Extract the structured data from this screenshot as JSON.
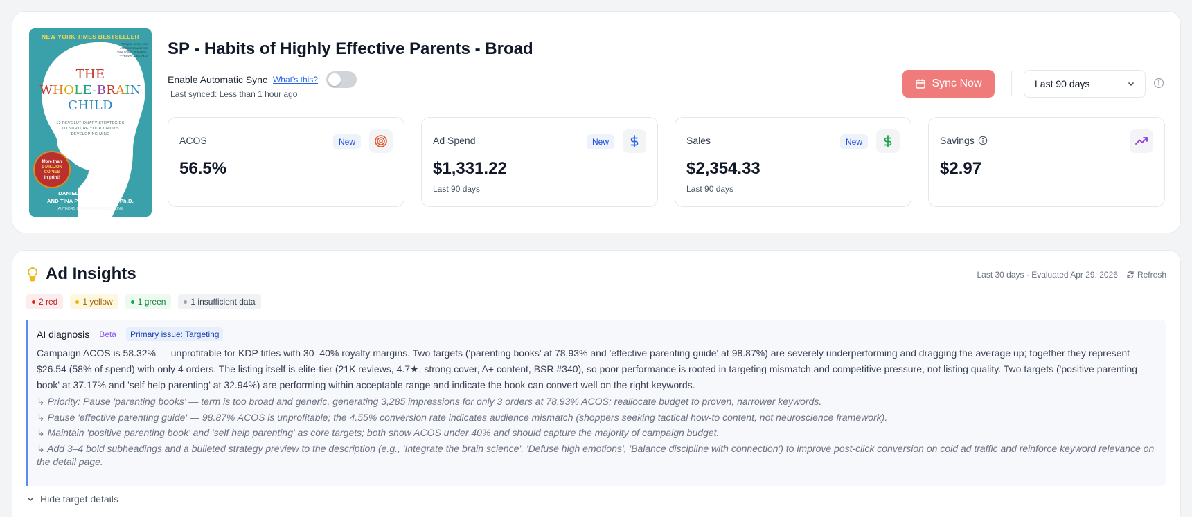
{
  "book_cover": {
    "nyt": "NEW YORK TIMES BESTSELLER",
    "quote": "\"Simple, smart, and effective solutions to your child's struggles.\" —Harvey Karp, M.D.",
    "title_line1": "THE",
    "title_line2": "WHOLE-BRAIN",
    "title_line3": "CHILD",
    "subtitle_line1": "12 REVOLUTIONARY STRATEGIES",
    "subtitle_line2": "TO NURTURE YOUR CHILD'S",
    "subtitle_line3": "DEVELOPING MIND",
    "badge_line1": "More than",
    "badge_line2": "1 MILLION",
    "badge_line3": "COPIES",
    "badge_line4": "in print!",
    "author1": "DANIEL J. SIEGEL, M.D.,",
    "author2": "AND TINA PAYNE BRYSON, Ph.D.",
    "authors_note": "AUTHORS OF NO-DRAMA DISCIPLINE"
  },
  "header": {
    "title": "SP - Habits of Highly Effective Parents - Broad",
    "sync_label": "Enable Automatic Sync",
    "whats_this": "What's this?",
    "last_synced": "Last synced: Less than 1 hour ago",
    "sync_button": "Sync Now",
    "range_value": "Last 90 days"
  },
  "metrics": {
    "acos": {
      "label": "ACOS",
      "badge": "New",
      "value": "56.5%"
    },
    "ad_spend": {
      "label": "Ad Spend",
      "badge": "New",
      "value": "$1,331.22",
      "sub": "Last 90 days"
    },
    "sales": {
      "label": "Sales",
      "badge": "New",
      "value": "$2,354.33",
      "sub": "Last 90 days"
    },
    "savings": {
      "label": "Savings",
      "value": "$2.97"
    }
  },
  "insights": {
    "title": "Ad Insights",
    "meta": "Last 30 days · Evaluated Apr 29, 2026",
    "refresh": "Refresh",
    "chips": {
      "red": "2 red",
      "yellow": "1 yellow",
      "green": "1 green",
      "insufficient": "1 insufficient data"
    },
    "diagnosis": {
      "title": "AI diagnosis",
      "beta": "Beta",
      "primary": "Primary issue: Targeting",
      "body": "Campaign ACOS is 58.32% — unprofitable for KDP titles with 30–40% royalty margins. Two targets ('parenting books' at 78.93% and 'effective parenting guide' at 98.87%) are severely underperforming and dragging the average up; together they represent $26.54 (58% of spend) with only 4 orders. The listing itself is elite-tier (21K reviews, 4.7★, strong cover, A+ content, BSR #340), so poor performance is rooted in targeting mismatch and competitive pressure, not listing quality. Two targets ('positive parenting book' at 37.17% and 'self help parenting' at 32.94%) are performing within acceptable range and indicate the book can convert well on the right keywords.",
      "rec1": "↳ Priority: Pause 'parenting books' — term is too broad and generic, generating 3,285 impressions for only 3 orders at 78.93% ACOS; reallocate budget to proven, narrower keywords.",
      "rec2": "↳ Pause 'effective parenting guide' — 98.87% ACOS is unprofitable; the 4.55% conversion rate indicates audience mismatch (shoppers seeking tactical how-to content, not neuroscience framework).",
      "rec3": "↳ Maintain 'positive parenting book' and 'self help parenting' as core targets; both show ACOS under 40% and should capture the majority of campaign budget.",
      "rec4": "↳ Add 3–4 bold subheadings and a bulleted strategy preview to the description (e.g., 'Integrate the brain science', 'Defuse high emotions', 'Balance discipline with connection') to improve post-click conversion on cold ad traffic and reinforce keyword relevance on the detail page."
    },
    "hide_details": "Hide target details"
  },
  "colors": {
    "sync_button": "#ef7b7b",
    "badge_blue": "#1d4ed8",
    "accent_border": "#5b8def",
    "red": "#dc2626",
    "yellow": "#eab308",
    "green": "#16a34a",
    "gray": "#9ca3af"
  },
  "icons": {
    "cover_art": "child-head-silhouette",
    "sync": "calendar-icon",
    "range": "chevron-down-icon",
    "info": "info-icon",
    "acos": "target-icon",
    "ad_spend": "dollar-icon",
    "sales": "dollar-icon",
    "savings": "trending-up-icon",
    "insights": "lightbulb-icon",
    "refresh": "refresh-icon",
    "hide": "chevron-down-icon"
  }
}
